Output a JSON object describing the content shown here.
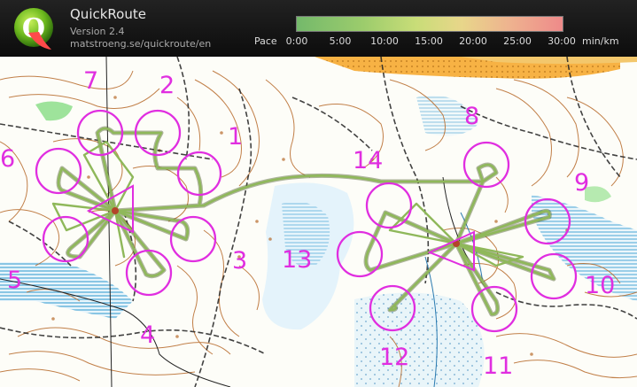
{
  "header": {
    "title": "QuickRoute",
    "version": "Version 2.4",
    "url": "matstroeng.se/quickroute/en",
    "logo_letter": "Q"
  },
  "pace_scale": {
    "label": "Pace",
    "ticks": [
      "0:00",
      "5:00",
      "10:00",
      "15:00",
      "20:00",
      "25:00",
      "30:00"
    ],
    "unit": "min/km"
  },
  "course": {
    "control_color": "#e02ee0",
    "route_color": "#7fa64c",
    "controls": [
      {
        "number": "1"
      },
      {
        "number": "2"
      },
      {
        "number": "3"
      },
      {
        "number": "4"
      },
      {
        "number": "5"
      },
      {
        "number": "6"
      },
      {
        "number": "7"
      },
      {
        "number": "8"
      },
      {
        "number": "9"
      },
      {
        "number": "10"
      },
      {
        "number": "11"
      },
      {
        "number": "12"
      },
      {
        "number": "13"
      },
      {
        "number": "14"
      }
    ]
  }
}
